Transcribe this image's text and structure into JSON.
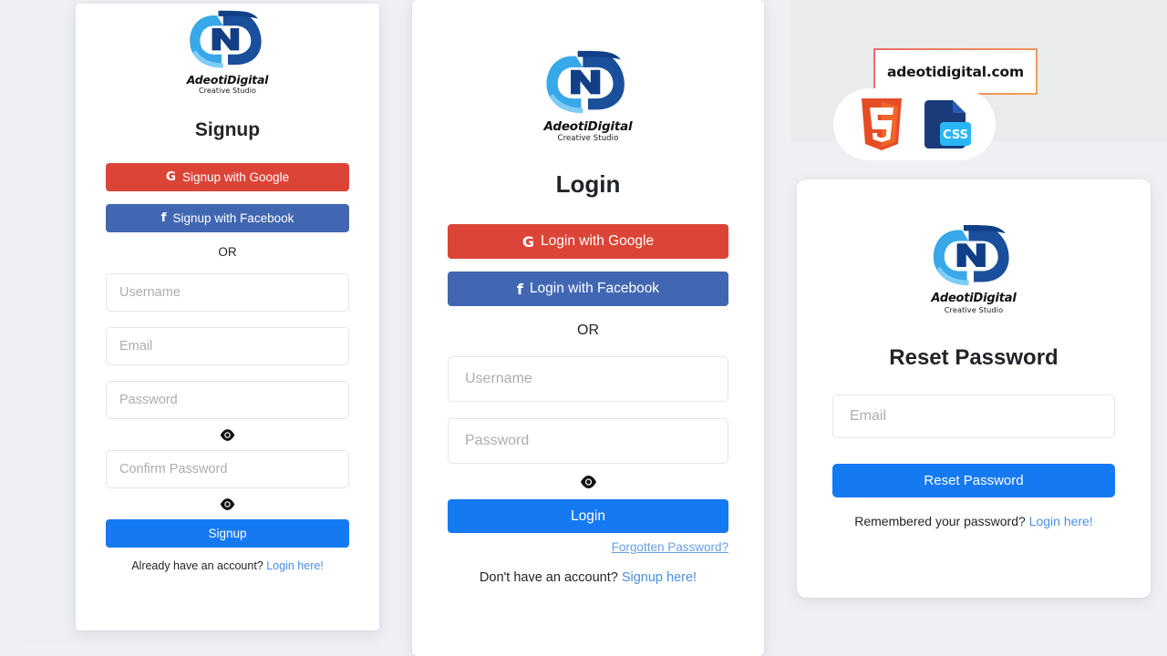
{
  "brand": {
    "name": "AdeotiDigital",
    "tagline": "Creative Studio",
    "logo_icon": "adeoti-ad-monogram-icon",
    "colors": {
      "light_blue": "#38a8e8",
      "dark_blue": "#1a4f9c",
      "deep_blue": "#103f86"
    }
  },
  "colors": {
    "google_red": "#dc4437",
    "facebook_blue": "#4267b2",
    "primary_blue": "#1579f2",
    "link_blue": "#4a90e2",
    "page_bg": "#eef0f4",
    "panel_bg": "#edeff3",
    "topright_bg": "#eaebeb",
    "url_border_from": "#e96a6a",
    "url_border_to": "#f0a355"
  },
  "signup_card": {
    "title": "Signup",
    "google_button": {
      "label": "Signup with Google",
      "icon": "google-g-icon"
    },
    "facebook_button": {
      "label": "Signup with Facebook",
      "icon": "facebook-f-icon"
    },
    "divider": "OR",
    "fields": [
      {
        "name": "username",
        "placeholder": "Username",
        "value": ""
      },
      {
        "name": "email",
        "placeholder": "Email",
        "value": ""
      },
      {
        "name": "password",
        "placeholder": "Password",
        "value": ""
      },
      {
        "name": "confirm_password",
        "placeholder": "Confirm Password",
        "value": ""
      }
    ],
    "password_toggle_icon": "eye-icon",
    "confirm_toggle_icon": "eye-icon",
    "submit_label": "Signup",
    "footer_text": "Already have an account?",
    "footer_link": "Login here!"
  },
  "login_card": {
    "title": "Login",
    "google_button": {
      "label": "Login with Google",
      "icon": "google-g-icon"
    },
    "facebook_button": {
      "label": "Login with Facebook",
      "icon": "facebook-f-icon"
    },
    "divider": "OR",
    "fields": [
      {
        "name": "username",
        "placeholder": "Username",
        "value": ""
      },
      {
        "name": "password",
        "placeholder": "Password",
        "value": ""
      }
    ],
    "password_toggle_icon": "eye-icon",
    "submit_label": "Login",
    "forgot_link": "Forgotten Password?",
    "footer_text": "Don't have an account?",
    "footer_link": "Signup here!"
  },
  "reset_card": {
    "title": "Reset Password",
    "fields": [
      {
        "name": "email",
        "placeholder": "Email",
        "value": ""
      }
    ],
    "submit_label": "Reset Password",
    "footer_text": "Remembered your password?",
    "footer_link": "Login here!"
  },
  "badge": {
    "url": "adeotidigital.com",
    "tech_icons": [
      {
        "name": "html5-icon",
        "label": "5"
      },
      {
        "name": "css3-file-icon",
        "label": "CSS"
      }
    ]
  }
}
